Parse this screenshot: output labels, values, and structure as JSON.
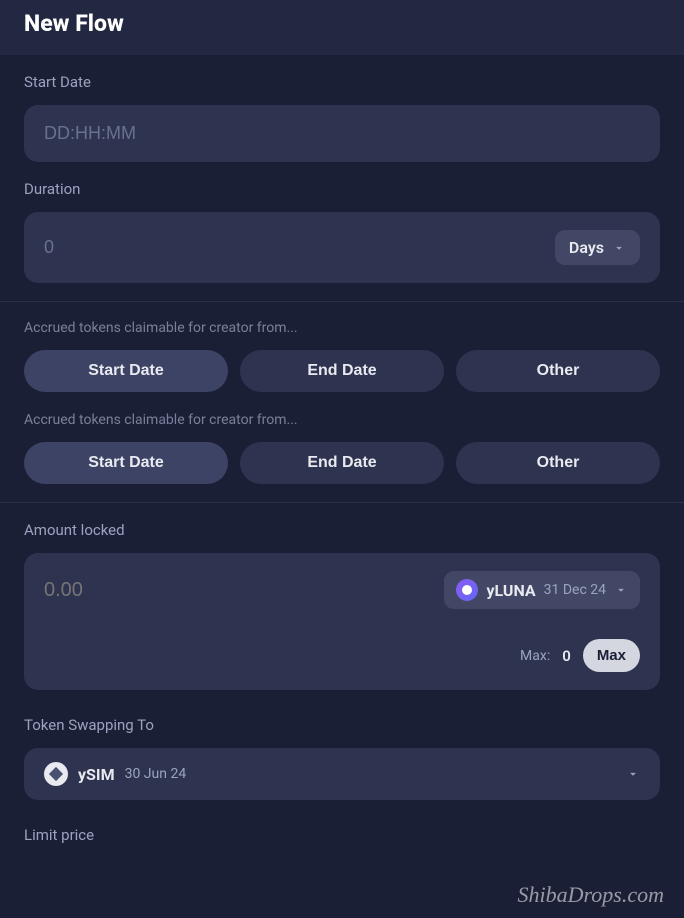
{
  "header": {
    "title": "New Flow"
  },
  "start_date": {
    "label": "Start Date",
    "placeholder": "DD:HH:MM"
  },
  "duration": {
    "label": "Duration",
    "placeholder": "0",
    "unit": "Days"
  },
  "accrued1": {
    "label": "Accrued tokens claimable for creator from...",
    "options": [
      "Start Date",
      "End Date",
      "Other"
    ]
  },
  "accrued2": {
    "label": "Accrued tokens claimable for creator from...",
    "options": [
      "Start Date",
      "End Date",
      "Other"
    ]
  },
  "amount_locked": {
    "label": "Amount locked",
    "placeholder": "0.00",
    "token_name": "yLUNA",
    "token_date": "31 Dec 24",
    "max_label": "Max:",
    "max_value": "0",
    "max_button": "Max"
  },
  "token_swapping": {
    "label": "Token Swapping To",
    "token_name": "ySIM",
    "token_date": "30 Jun 24"
  },
  "limit_price": {
    "label": "Limit price"
  },
  "watermark": "ShibaDrops.com"
}
